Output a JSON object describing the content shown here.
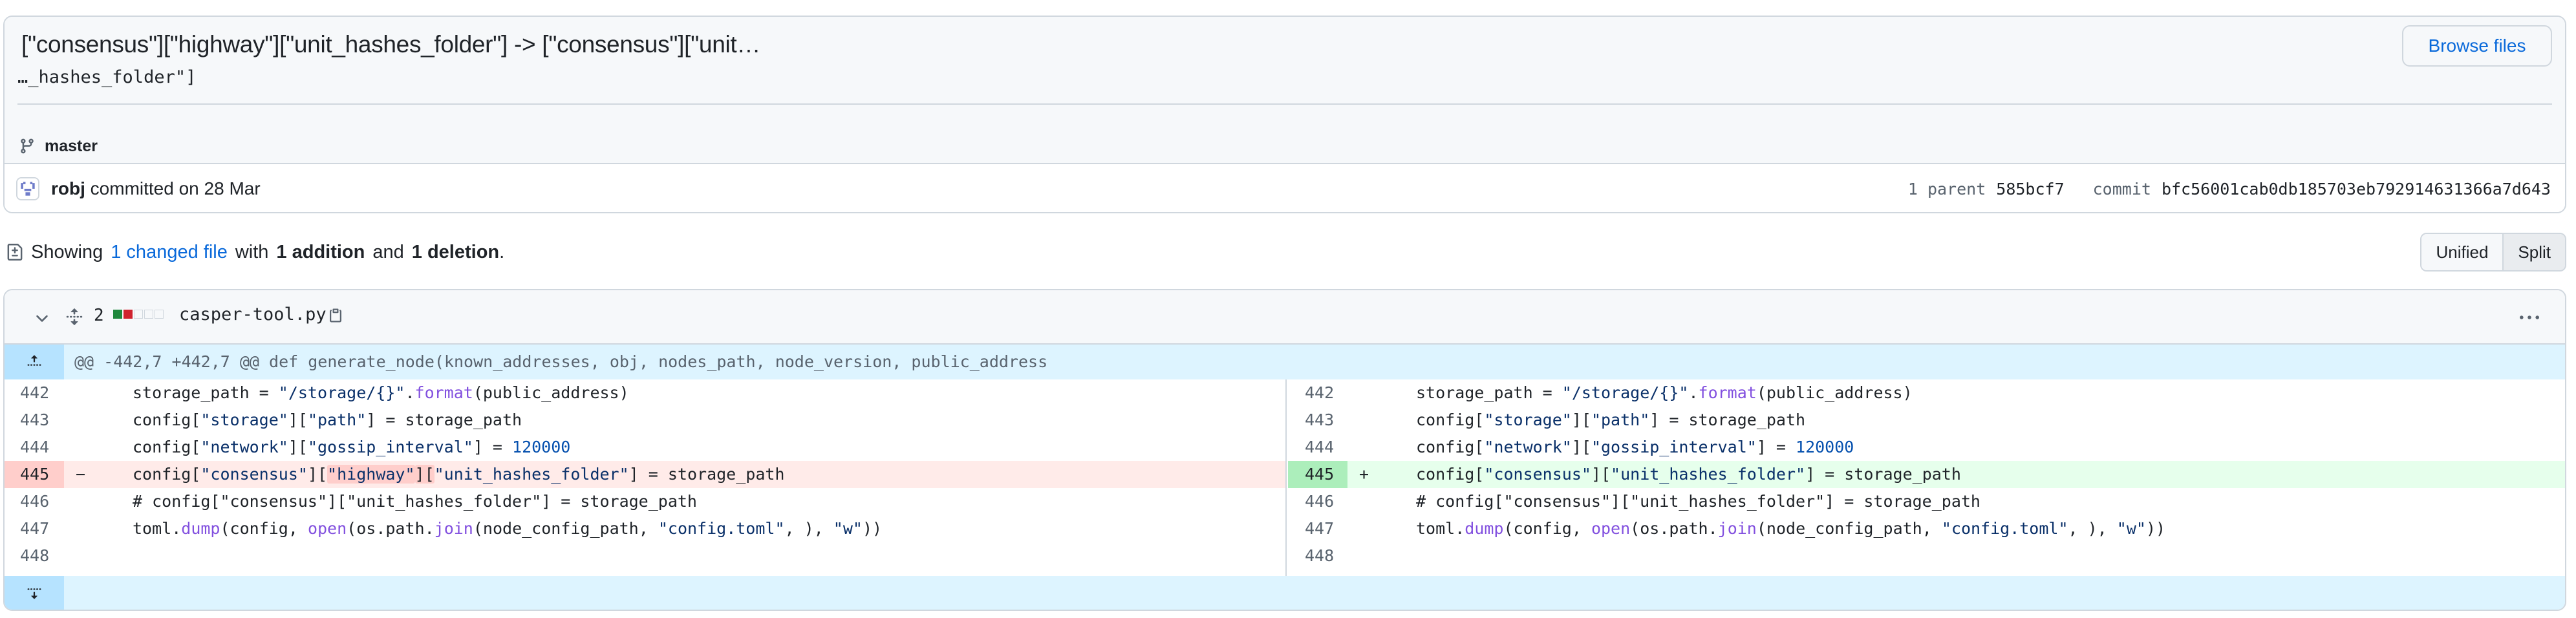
{
  "commit": {
    "title": "[\"consensus\"][\"highway\"][\"unit_hashes_folder\"] -> [\"consensus\"][\"unit…",
    "title_cont": "…_hashes_folder\"]",
    "browse_files": "Browse files",
    "branch": "master",
    "author": "robj",
    "action": "committed on 28 Mar",
    "parent_label": "1 parent",
    "parent_sha": "585bcf7",
    "commit_label": "commit",
    "commit_sha": "bfc56001cab0db185703eb792914631366a7d643"
  },
  "summary": {
    "showing": "Showing",
    "changed_files": "1 changed file",
    "with": "with",
    "additions": "1 addition",
    "and": "and",
    "deletions": "1 deletion",
    "period": ".",
    "unified": "Unified",
    "split": "Split"
  },
  "file": {
    "change_count": "2",
    "name": "casper-tool.py",
    "hunk_header": "@@ -442,7 +442,7 @@ def generate_node(known_addresses, obj, nodes_path, node_version, public_address",
    "left_lines": [
      {
        "num": "442",
        "type": "ctx"
      },
      {
        "num": "443",
        "type": "ctx"
      },
      {
        "num": "444",
        "type": "ctx"
      },
      {
        "num": "445",
        "type": "del",
        "marker": "−"
      },
      {
        "num": "446",
        "type": "ctx"
      },
      {
        "num": "447",
        "type": "ctx"
      },
      {
        "num": "448",
        "type": "ctx"
      }
    ],
    "right_lines": [
      {
        "num": "442",
        "type": "ctx"
      },
      {
        "num": "443",
        "type": "ctx"
      },
      {
        "num": "444",
        "type": "ctx"
      },
      {
        "num": "445",
        "type": "add",
        "marker": "+"
      },
      {
        "num": "446",
        "type": "ctx"
      },
      {
        "num": "447",
        "type": "ctx"
      },
      {
        "num": "448",
        "type": "ctx"
      }
    ],
    "code": {
      "l442_a": "storage_path = ",
      "l442_b": "\"/storage/{}\"",
      "l442_c": ".",
      "l442_d": "format",
      "l442_e": "(public_address)",
      "l443_a": "config[",
      "l443_b": "\"storage\"",
      "l443_c": "][",
      "l443_d": "\"path\"",
      "l443_e": "] = storage_path",
      "l444_a": "config[",
      "l444_b": "\"network\"",
      "l444_c": "][",
      "l444_d": "\"gossip_interval\"",
      "l444_e": "] = ",
      "l444_f": "120000",
      "l445l_a": "config[",
      "l445l_b": "\"consensus\"",
      "l445l_c": "][",
      "l445l_d": "\"highway\"",
      "l445l_e": "][",
      "l445l_f": "\"unit_hashes_folder\"",
      "l445l_g": "] = storage_path",
      "l445r_a": "config[",
      "l445r_b": "\"consensus\"",
      "l445r_c": "][",
      "l445r_d": "\"unit_hashes_folder\"",
      "l445r_e": "] = storage_path",
      "l446": "# config[\"consensus\"][\"unit_hashes_folder\"] = storage_path",
      "l447_a": "toml.",
      "l447_b": "dump",
      "l447_c": "(config, ",
      "l447_d": "open",
      "l447_e": "(os.path.",
      "l447_f": "join",
      "l447_g": "(node_config_path, ",
      "l447_h": "\"config.toml\"",
      "l447_i": ", ), ",
      "l447_j": "\"w\"",
      "l447_k": "))"
    }
  },
  "colors": {
    "link": "#0969da",
    "add_bg": "#e6ffec",
    "del_bg": "#ffebe9",
    "hunk_bg": "#ddf4ff"
  },
  "icons": [
    "git-branch-icon",
    "file-diff-icon",
    "chevron-down-icon",
    "expand-icon",
    "copy-icon",
    "kebab-icon",
    "expand-up-icon",
    "expand-down-icon"
  ]
}
